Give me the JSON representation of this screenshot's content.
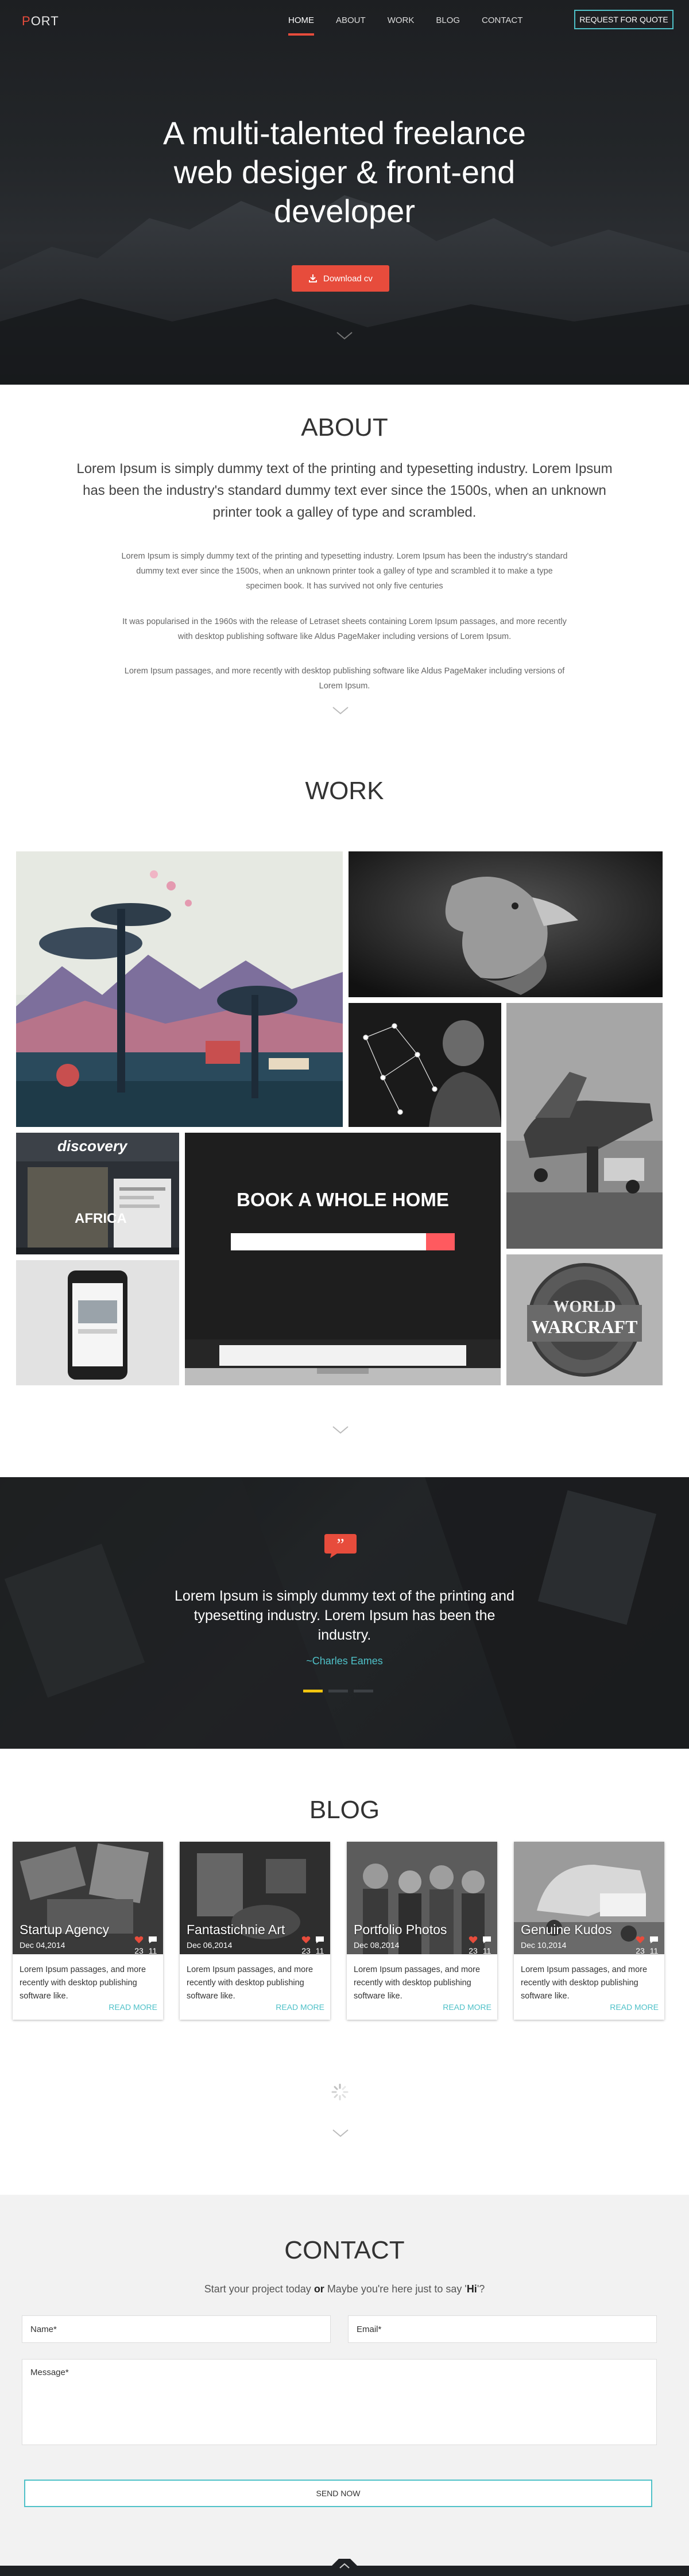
{
  "nav": {
    "logo_first": "P",
    "logo_rest": "ORT",
    "items": [
      {
        "label": "HOME",
        "active": true
      },
      {
        "label": "ABOUT",
        "active": false
      },
      {
        "label": "WORK",
        "active": false
      },
      {
        "label": "BLOG",
        "active": false
      },
      {
        "label": "CONTACT",
        "active": false
      }
    ],
    "quote_button": "REQUEST FOR QUOTE"
  },
  "hero": {
    "title_line1": "A multi-talented freelance",
    "title_line2": "web desiger & front-end",
    "title_line3": "developer",
    "cta": "Download cv"
  },
  "about": {
    "title": "ABOUT",
    "lead": "Lorem Ipsum is simply dummy text of the printing and typesetting industry. Lorem Ipsum has been the industry's standard dummy text ever since the 1500s, when an unknown printer took a galley of type and scrambled.",
    "p1": "Lorem Ipsum is simply dummy text of the printing and typesetting industry. Lorem Ipsum has been the industry's standard dummy text ever since the 1500s, when an unknown printer took a galley of type and scrambled it to make a type specimen book. It has survived not only five centuries",
    "p2": "It was popularised in the 1960s with the release of Letraset sheets containing Lorem Ipsum passages, and more recently with desktop publishing software like Aldus PageMaker including versions of Lorem Ipsum.",
    "p3": "Lorem Ipsum passages, and more recently with desktop publishing software like Aldus PageMaker including versions of Lorem Ipsum."
  },
  "work": {
    "title": "WORK",
    "tiles": [
      {
        "text": "discovery",
        "sub": "AFRICA"
      },
      {
        "text": "BOOK A WHOLE HOME"
      },
      {
        "text": "WORLD",
        "sub": "WARCRAFT"
      }
    ]
  },
  "testimonial": {
    "text": "Lorem Ipsum is simply dummy text of the printing and typesetting industry. Lorem Ipsum has been the industry.",
    "author": "~Charles Eames"
  },
  "blog": {
    "title": "BLOG",
    "posts": [
      {
        "title": "Startup Agency",
        "date": "Dec 04,2014",
        "likes": "23",
        "comments": "11",
        "excerpt": "Lorem Ipsum passages, and more recently with desktop publishing software like.",
        "more": "READ MORE"
      },
      {
        "title": "Fantastichnie Art",
        "date": "Dec 06,2014",
        "likes": "23",
        "comments": "11",
        "excerpt": "Lorem Ipsum passages, and more recently with desktop publishing software like.",
        "more": "READ MORE"
      },
      {
        "title": "Portfolio Photos",
        "date": "Dec 08,2014",
        "likes": "23",
        "comments": "11",
        "excerpt": "Lorem Ipsum passages, and more recently with desktop publishing software like.",
        "more": "READ MORE"
      },
      {
        "title": "Genuine Kudos",
        "date": "Dec 10,2014",
        "likes": "23",
        "comments": "11",
        "excerpt": "Lorem Ipsum passages, and more recently with desktop publishing software like.",
        "more": "READ MORE"
      }
    ]
  },
  "contact": {
    "title": "CONTACT",
    "sub_a": "Start your project today ",
    "sub_or": "or",
    "sub_b": " Maybe you're here just to say '",
    "sub_hi": "Hi",
    "sub_c": "'?",
    "name_placeholder": "Name*",
    "email_placeholder": "Email*",
    "message_placeholder": "Message*",
    "send": "SEND NOW"
  },
  "colors": {
    "accent": "#e74c3c",
    "teal": "#4fc1c8",
    "yellow": "#f1c40f"
  }
}
